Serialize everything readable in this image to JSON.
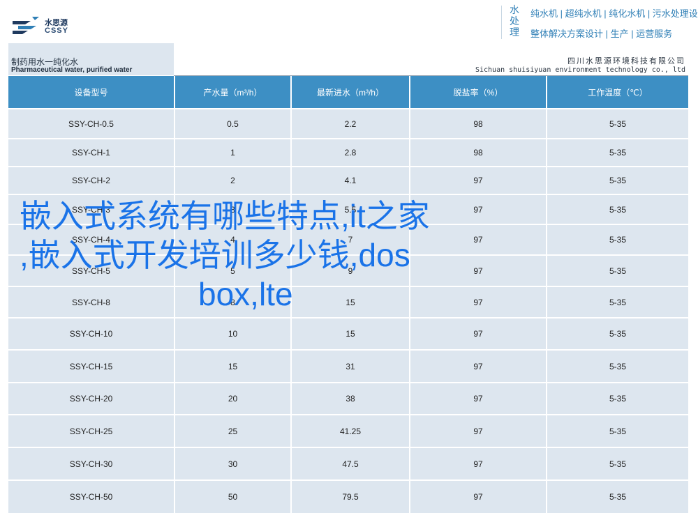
{
  "header": {
    "logo_cn": "水思源",
    "logo_en": "CSSY",
    "vertical_title": "水处理",
    "slogan_1": "纯水机 | 超纯水机 | 纯化水机 | 污水处理设备",
    "slogan_2": "整体解决方案设计 | 生产 | 运营服务"
  },
  "title_bar": {
    "left_cn": "制药用水一纯化水",
    "left_en": "Pharmaceutical water, purified water",
    "right_cn": "四川水思源环境科技有限公司",
    "right_en": "Sichuan shuisiyuan environment technology co., ltd"
  },
  "table": {
    "headers": [
      "设备型号",
      "产水量（m³/h）",
      "最新进水（m³/h）",
      "脱盐率（%）",
      "工作温度（℃）"
    ],
    "rows": [
      [
        "SSY-CH-0.5",
        "0.5",
        "2.2",
        "98",
        "5-35"
      ],
      [
        "SSY-CH-1",
        "1",
        "2.8",
        "98",
        "5-35"
      ],
      [
        "SSY-CH-2",
        "2",
        "4.1",
        "97",
        "5-35"
      ],
      [
        "SSY-CH-3",
        "3",
        "5.5",
        "97",
        "5-35"
      ],
      [
        "SSY-CH-4",
        "4",
        "7",
        "97",
        "5-35"
      ],
      [
        "SSY-CH-5",
        "5",
        "9",
        "97",
        "5-35"
      ],
      [
        "SSY-CH-8",
        "8",
        "15",
        "97",
        "5-35"
      ],
      [
        "SSY-CH-10",
        "10",
        "15",
        "97",
        "5-35"
      ],
      [
        "SSY-CH-15",
        "15",
        "31",
        "97",
        "5-35"
      ],
      [
        "SSY-CH-20",
        "20",
        "38",
        "97",
        "5-35"
      ],
      [
        "SSY-CH-25",
        "25",
        "41.25",
        "97",
        "5-35"
      ],
      [
        "SSY-CH-30",
        "30",
        "47.5",
        "97",
        "5-35"
      ],
      [
        "SSY-CH-50",
        "50",
        "79.5",
        "97",
        "5-35"
      ]
    ]
  },
  "overlay": {
    "line_1": "嵌入式系统有哪些特点,it之家",
    "line_2": ",嵌入式开发培训多少钱,dos",
    "line_3": "box,lte"
  },
  "colors": {
    "header_blue": "#3d8fc4",
    "row_bg": "#dde6ef",
    "overlay_text": "#1a73e8",
    "slogan_text": "#2f7fb6"
  }
}
